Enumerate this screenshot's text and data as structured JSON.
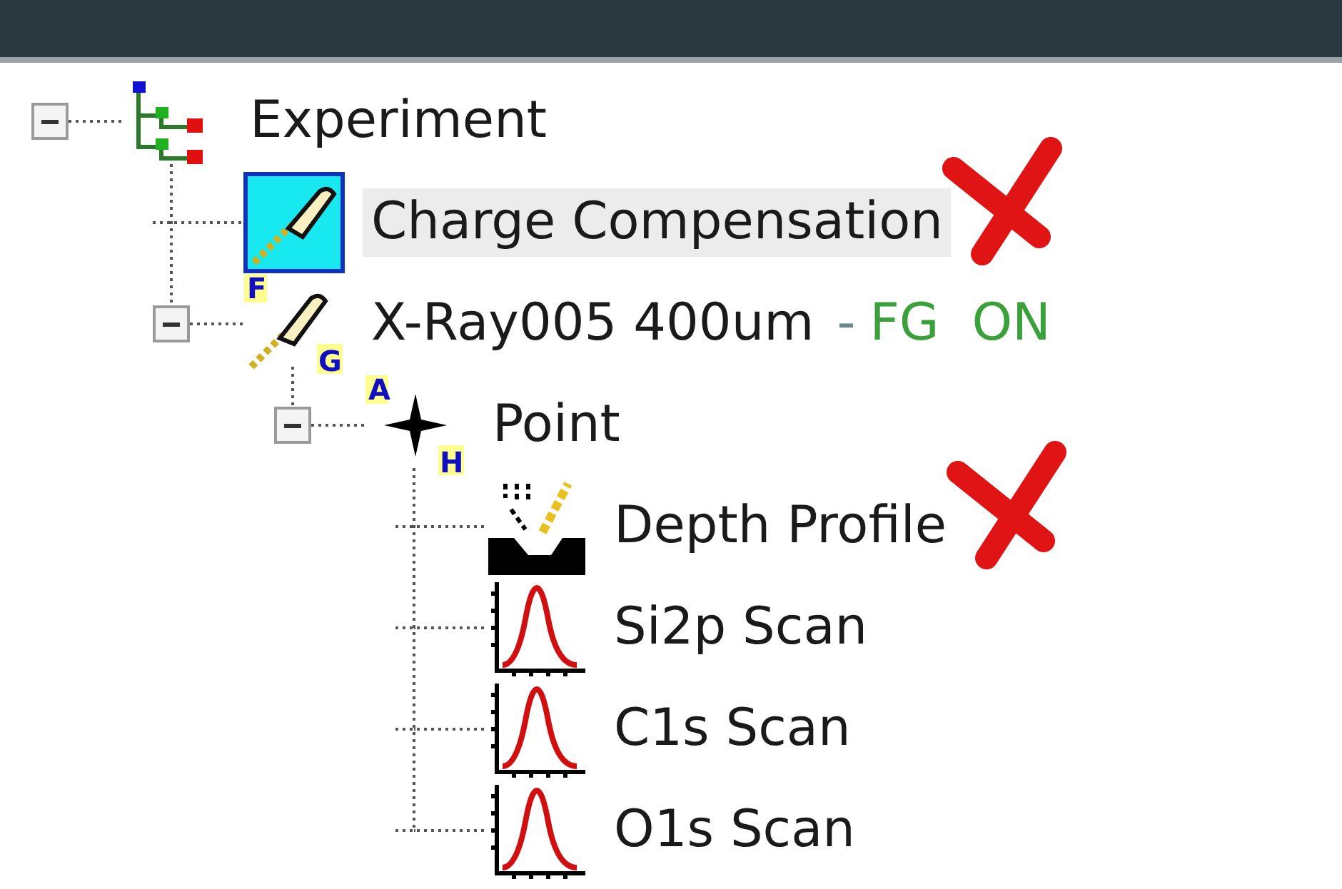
{
  "tree": [
    {
      "label": "Experiment",
      "kind": "experiment",
      "expanded": true,
      "selected": false,
      "crossed_out": false,
      "children": [
        {
          "label": "Charge Compensation",
          "kind": "charge",
          "selected": true,
          "crossed_out": true
        },
        {
          "label": "X-Ray005 400um",
          "kind": "source",
          "icon_letters": [
            "F",
            "G"
          ],
          "separator": "-",
          "status": "FG  ON",
          "expanded": true,
          "selected": false,
          "crossed_out": false,
          "children": [
            {
              "label": "Point",
              "kind": "point",
              "icon_letters": [
                "A",
                "H"
              ],
              "expanded": true,
              "selected": false,
              "crossed_out": false,
              "children": [
                {
                  "label": "Depth Profile",
                  "kind": "depth",
                  "selected": false,
                  "crossed_out": true
                },
                {
                  "label": "Si2p Scan",
                  "kind": "scan",
                  "selected": false,
                  "crossed_out": false
                },
                {
                  "label": "C1s Scan",
                  "kind": "scan",
                  "selected": false,
                  "crossed_out": false
                },
                {
                  "label": "O1s Scan",
                  "kind": "scan",
                  "selected": false,
                  "crossed_out": false
                }
              ]
            }
          ]
        }
      ]
    }
  ]
}
